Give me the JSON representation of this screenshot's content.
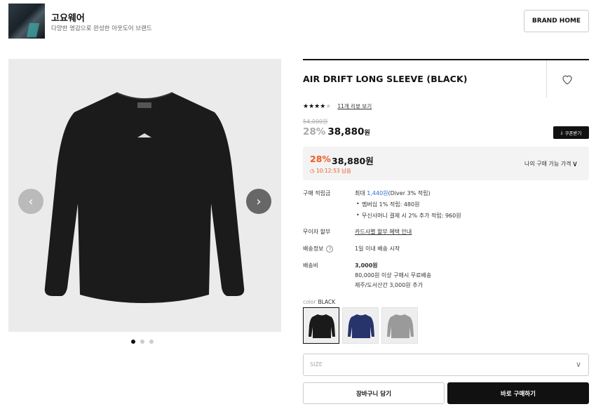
{
  "brand": {
    "name": "고요웨어",
    "description": "다양한 영감으로 완성한 아웃도어 브랜드",
    "home_button": "BRAND HOME"
  },
  "gallery": {
    "image_count": 3,
    "active_index": 0,
    "prev_icon": "chevron-left-icon",
    "next_icon": "chevron-right-icon"
  },
  "product": {
    "title": "AIR DRIFT LONG SLEEVE (BLACK)",
    "rating": 4,
    "rating_max": 5,
    "review_link": "11개 리뷰 보기",
    "original_price": "54,000원",
    "discount": "28%",
    "price": "38,880",
    "currency": "원",
    "coupon_button": "쿠폰받기"
  },
  "my_price": {
    "discount": "28%",
    "price": "38,880원",
    "timer": "10:12:53 남음",
    "label": "나의 구매 가능 가격"
  },
  "info": {
    "points": {
      "label": "구매 적립금",
      "prefix": "최대 ",
      "amount": "1,440원",
      "suffix": "(Diver 3% 적립)",
      "bullets": [
        "멤버십 1% 적립: 480원",
        "무신사머니 결제 시 2% 추가 적립: 960원"
      ]
    },
    "installment": {
      "label": "무이자 할부",
      "value": "카드사별 할부 혜택 안내"
    },
    "shipping_info": {
      "label": "배송정보",
      "value": "1일 이내 배송 시작"
    },
    "shipping_fee": {
      "label": "배송비",
      "amount": "3,000원",
      "lines": [
        "80,000원 이상 구매시 무료배송",
        "제주/도서산간 3,000원 추가"
      ]
    }
  },
  "color": {
    "label": "color",
    "selected": "BLACK",
    "options": [
      {
        "name": "black",
        "fill": "#1a1a1a"
      },
      {
        "name": "navy",
        "fill": "#27336b"
      },
      {
        "name": "gray",
        "fill": "#9a9a9a"
      }
    ]
  },
  "size_select": {
    "placeholder": "SIZE"
  },
  "actions": {
    "cart": "장바구니 담기",
    "buy": "바로 구매하기"
  },
  "colors": {
    "accent": "#f15a24",
    "link": "#2a6fd6",
    "primary": "#111111"
  }
}
